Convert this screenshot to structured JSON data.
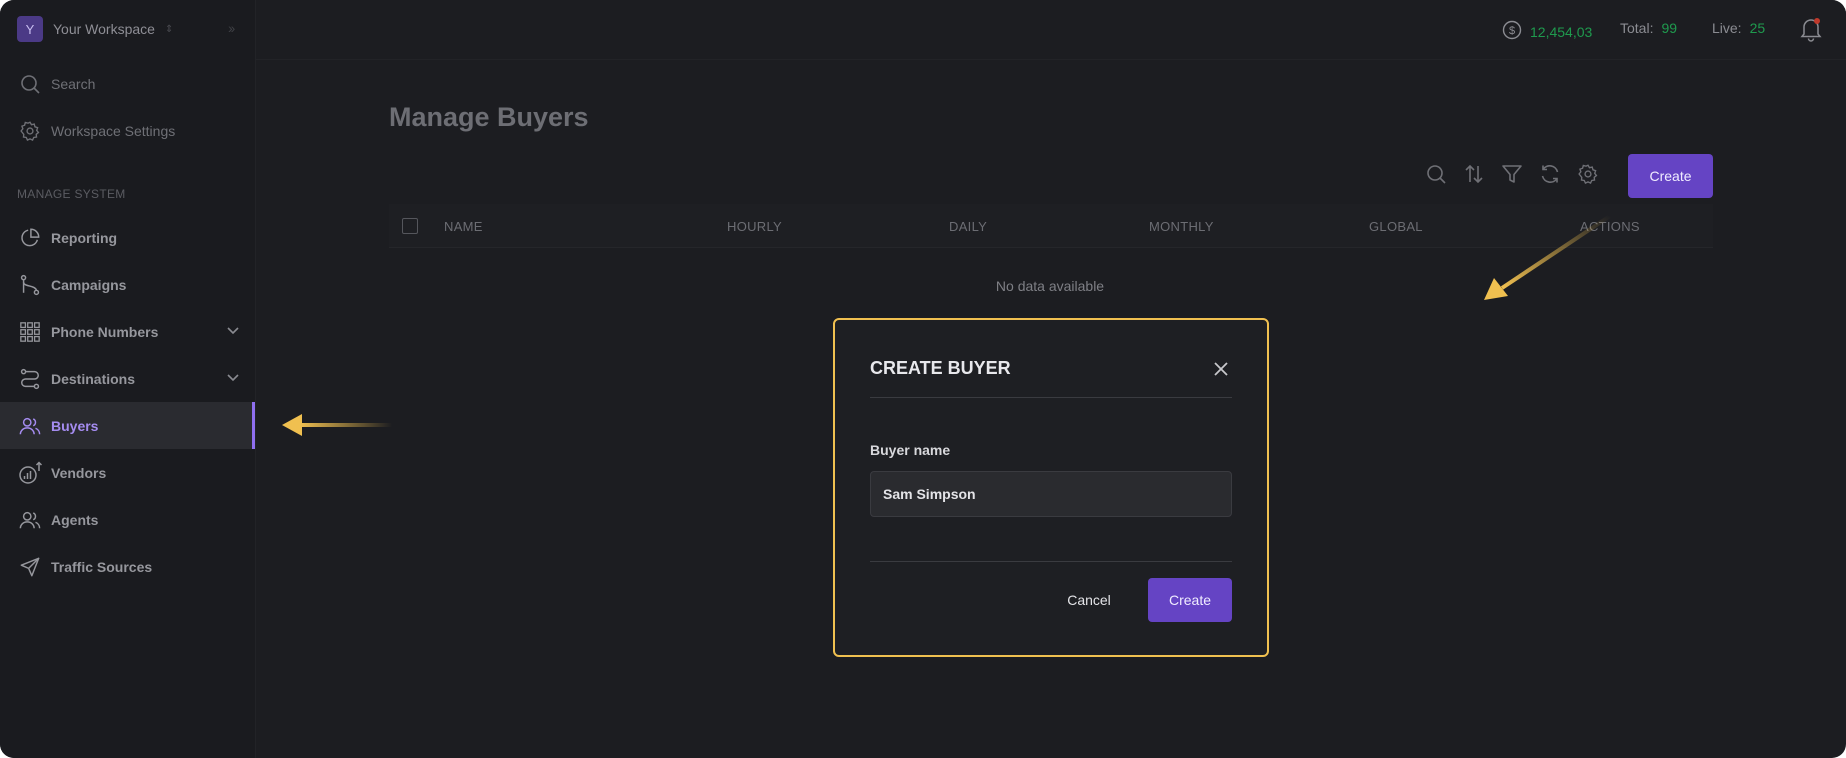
{
  "workspace": {
    "avatar_letter": "Y",
    "name": "Your Workspace"
  },
  "sidebar": {
    "search_label": "Search",
    "settings_label": "Workspace Settings",
    "section_label": "MANAGE SYSTEM",
    "items": [
      {
        "label": "Reporting",
        "icon": "pie-chart-icon"
      },
      {
        "label": "Campaigns",
        "icon": "git-branch-icon"
      },
      {
        "label": "Phone Numbers",
        "icon": "dialpad-grid-icon",
        "expandable": true
      },
      {
        "label": "Destinations",
        "icon": "route-icon",
        "expandable": true
      },
      {
        "label": "Buyers",
        "icon": "users-icon",
        "active": true
      },
      {
        "label": "Vendors",
        "icon": "signal-chart-icon"
      },
      {
        "label": "Agents",
        "icon": "users-icon"
      },
      {
        "label": "Traffic Sources",
        "icon": "send-icon"
      }
    ]
  },
  "topbar": {
    "balance": "12,454,03",
    "total_label": "Total:",
    "total_value": "99",
    "live_label": "Live:",
    "live_value": "25"
  },
  "page": {
    "title": "Manage Buyers",
    "create_button": "Create",
    "columns": [
      "NAME",
      "HOURLY",
      "DAILY",
      "MONTHLY",
      "GLOBAL",
      "ACTIONS"
    ],
    "empty_text": "No data available"
  },
  "modal": {
    "title": "CREATE BUYER",
    "field_label": "Buyer name",
    "field_value": "Sam Simpson",
    "cancel_label": "Cancel",
    "create_label": "Create"
  },
  "colors": {
    "accent": "#6544c4",
    "active_text": "#a58cf0",
    "positive": "#1f9a4e",
    "highlight": "#f0c050"
  }
}
